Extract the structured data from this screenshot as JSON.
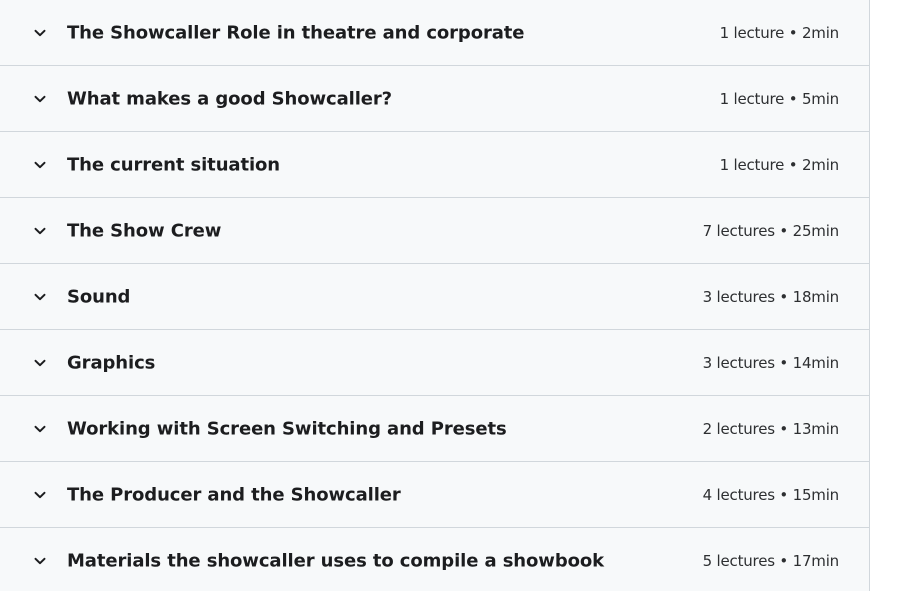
{
  "sections": [
    {
      "title": "The Showcaller Role in theatre and corporate",
      "meta": "1 lecture • 2min",
      "icon": "chevron-down-icon"
    },
    {
      "title": "What makes a good Showcaller?",
      "meta": "1 lecture • 5min",
      "icon": "chevron-down-icon"
    },
    {
      "title": "The current situation",
      "meta": "1 lecture • 2min",
      "icon": "chevron-down-icon"
    },
    {
      "title": "The Show Crew",
      "meta": "7 lectures • 25min",
      "icon": "chevron-down-icon"
    },
    {
      "title": "Sound",
      "meta": "3 lectures • 18min",
      "icon": "chevron-down-icon"
    },
    {
      "title": "Graphics",
      "meta": "3 lectures • 14min",
      "icon": "chevron-down-icon"
    },
    {
      "title": "Working with Screen Switching and Presets",
      "meta": "2 lectures • 13min",
      "icon": "chevron-down-icon"
    },
    {
      "title": "The Producer and the Showcaller",
      "meta": "4 lectures • 15min",
      "icon": "chevron-down-icon"
    },
    {
      "title": "Materials the showcaller uses to compile a showbook",
      "meta": "5 lectures • 17min",
      "icon": "chevron-down-icon"
    }
  ],
  "colors": {
    "background": "#f7f9fa",
    "text": "#1c1d1f",
    "divider": "#d1d7dc"
  }
}
